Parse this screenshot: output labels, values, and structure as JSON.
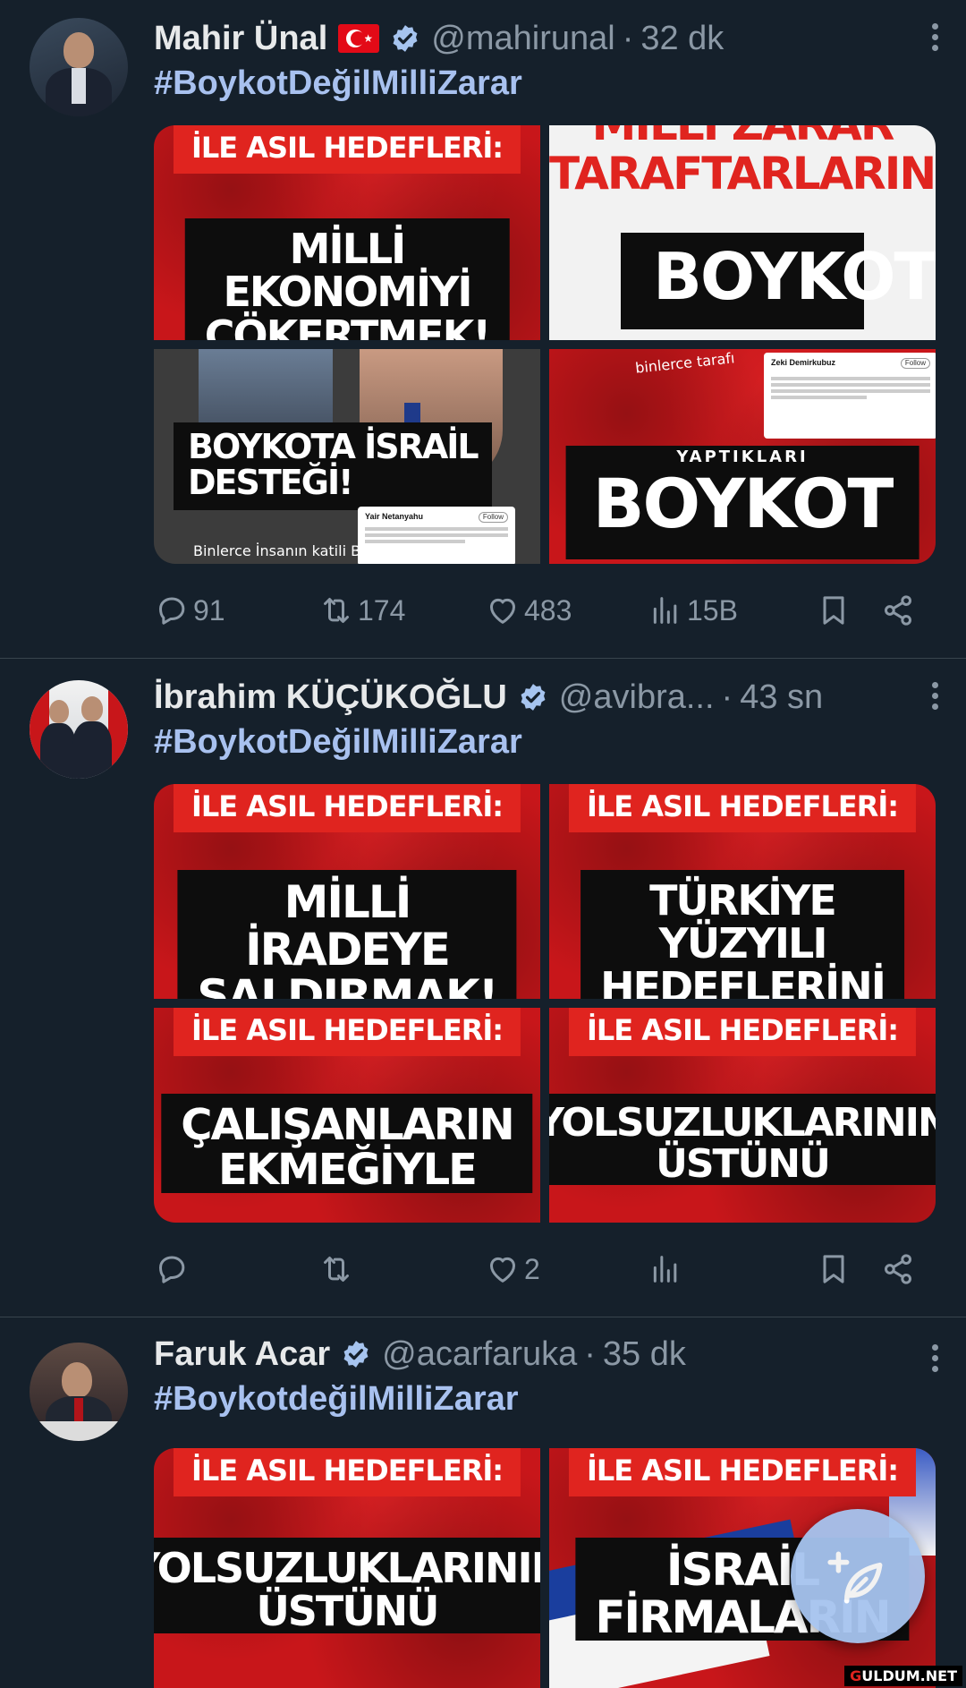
{
  "colors": {
    "background": "#15202b",
    "hashtag": "#a8c1ef",
    "muted": "#8b98a5",
    "fab": "#a6c4ef",
    "verified": "#a6c4ef",
    "poster_red": "#e0241f"
  },
  "tweets": [
    {
      "name": "Mahir Ünal",
      "handle": "@mahirunal",
      "time": "32 dk",
      "hashtag": "#BoykotDeğilMilliZarar",
      "images": [
        {
          "tag": "İLE ASIL HEDEFLERİ:",
          "headline": "MİLLİ EKONOMİYİ\nÇÖKERTMEK!"
        },
        {
          "top": "MİLLİ ZARAR\nTARAFTARLARINI",
          "headline": "BOYKOT"
        },
        {
          "headline": "BOYKOTA İSRAİL\nDESTEĞİ!",
          "caption": "Binlerce İnsanın katili Binyamin",
          "card_name": "Yair Netanyahu",
          "card_button": "Follow"
        },
        {
          "caption_top": "binlerce tarafı",
          "small": "YAPTIKLARI",
          "headline": "BOYKOT",
          "card_name": "Zeki Demirkubuz",
          "card_button": "Follow"
        }
      ],
      "actions": {
        "replies": "91",
        "retweets": "174",
        "likes": "483",
        "views": "15B"
      }
    },
    {
      "name": "İbrahim KÜÇÜKOĞLU",
      "handle": "@avibra...",
      "time": "43 sn",
      "hashtag": "#BoykotDeğilMilliZarar",
      "images": [
        {
          "tag": "İLE ASIL HEDEFLERİ:",
          "headline": "MİLLİ İRADEYE\nSALDIRMAK!"
        },
        {
          "tag": "İLE ASIL HEDEFLERİ:",
          "headline": "TÜRKİYE YÜZYILI\nHEDEFLERİNİ"
        },
        {
          "tag": "İLE ASIL HEDEFLERİ:",
          "headline": "ÇALIŞANLARIN\nEKMEĞİYLE"
        },
        {
          "tag": "İLE ASIL HEDEFLERİ:",
          "headline": "YOLSUZLUKLARININ\nÜSTÜNÜ"
        }
      ],
      "actions": {
        "replies": "",
        "retweets": "",
        "likes": "2",
        "views": ""
      }
    },
    {
      "name": "Faruk Acar",
      "handle": "@acarfaruka",
      "time": "35 dk",
      "hashtag": "#BoykotdeğilMilliZarar",
      "images": [
        {
          "tag": "İLE ASIL HEDEFLERİ:",
          "headline": "YOLSUZLUKLARININ\nÜSTÜNÜ"
        },
        {
          "tag": "İLE ASIL HEDEFLERİ:",
          "headline": "İSRAİL\nFİRMALARIN"
        }
      ]
    }
  ],
  "fab": {
    "icon": "compose-feather-plus-icon"
  },
  "watermark": {
    "g": "G",
    "rest": "ULDUM.NET"
  }
}
